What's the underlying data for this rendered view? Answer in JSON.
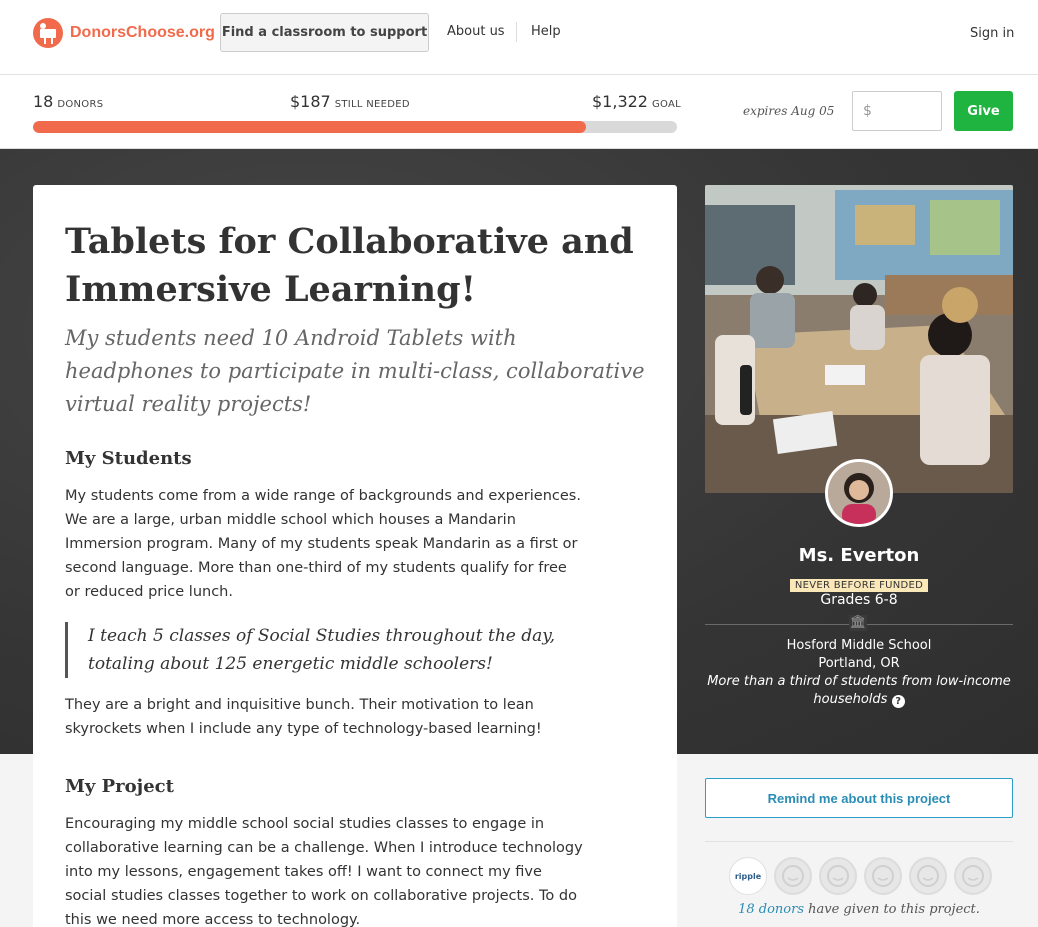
{
  "header": {
    "logo_text": "DonorsChoose.org",
    "find_label": "Find a classroom to support",
    "about_label": "About us",
    "help_label": "Help",
    "signin_label": "Sign in"
  },
  "funding": {
    "donors_count": "18",
    "donors_label": "DONORS",
    "needed_amount": "$187",
    "needed_label": "STILL NEEDED",
    "goal_amount": "$1,322",
    "goal_label": "GOAL",
    "progress_fraction": 0.859,
    "expires_text": "expires Aug 05",
    "amount_placeholder": "$",
    "give_label": "Give"
  },
  "project": {
    "title": "Tablets for Collaborative and Immersive Learning!",
    "subtitle": "My students need 10 Android Tablets with headphones to participate in multi-class, collaborative virtual reality projects!",
    "students_heading": "My Students",
    "students_para": "My students come from a wide range of backgrounds and experiences. We are a large, urban middle school which houses a Mandarin Immersion program. Many of my students speak Mandarin as a first or second language. More than one-third of my students qualify for free or reduced price lunch.",
    "quote": "I teach 5 classes of Social Studies throughout the day, totaling about 125 energetic middle schoolers!",
    "students_para2": "They are a bright and inquisitive bunch. Their motivation to lean skyrockets when I include any type of technology-based learning!",
    "project_heading": "My Project",
    "project_para": "Encouraging my middle school social studies classes to engage in collaborative learning can be a challenge. When I introduce technology into my lessons, engagement takes off! I want to connect my five social studies classes together to work on collaborative projects. To do this we need more access to technology."
  },
  "teacher": {
    "name": "Ms. Everton",
    "badge": "NEVER BEFORE FUNDED",
    "grades": "Grades 6-8",
    "school": "Hosford Middle School",
    "location": "Portland, OR",
    "poverty": "More than a third of students from low-income households"
  },
  "sidebar": {
    "remind_label": "Remind me about this project",
    "ripple_label": "ripple",
    "donors_link": "18 donors",
    "donors_suffix": " have given to this project."
  },
  "colors": {
    "brand_orange": "#f06a4b",
    "give_green": "#1fb33f",
    "link_blue": "#2a8db5"
  },
  "icons": [
    "logo-icon",
    "school-icon",
    "help-icon",
    "ripple-logo-icon",
    "donor-avatar-icon"
  ]
}
